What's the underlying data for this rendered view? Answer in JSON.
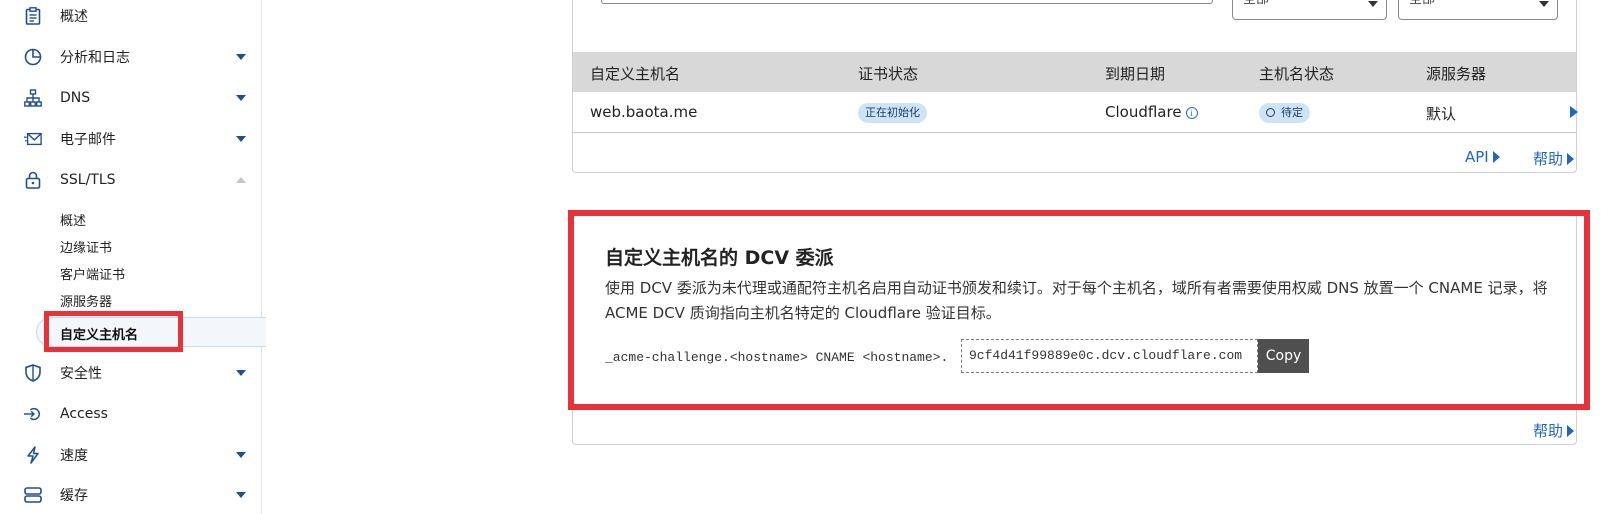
{
  "sidebar": {
    "items": [
      {
        "label": "概述",
        "icon": "clipboard-icon"
      },
      {
        "label": "分析和日志",
        "icon": "pie-chart-icon"
      },
      {
        "label": "DNS",
        "icon": "network-icon"
      },
      {
        "label": "电子邮件",
        "icon": "email-icon"
      },
      {
        "label": "SSL/TLS",
        "icon": "lock-icon"
      },
      {
        "label": "安全性",
        "icon": "shield-icon"
      },
      {
        "label": "Access",
        "icon": "access-icon"
      },
      {
        "label": "速度",
        "icon": "lightning-icon"
      },
      {
        "label": "缓存",
        "icon": "storage-icon"
      }
    ],
    "ssl_sub_items": [
      "概述",
      "边缘证书",
      "客户端证书",
      "源服务器",
      "自定义主机名"
    ]
  },
  "filters": {
    "status_select": "全部",
    "validation_select": "全部"
  },
  "table": {
    "headers": [
      "自定义主机名",
      "证书状态",
      "到期日期",
      "主机名状态",
      "源服务器"
    ],
    "row": {
      "hostname": "web.baota.me",
      "cert_status": "正在初始化",
      "expiry": "Cloudflare",
      "hostname_status": "待定",
      "origin": "默认"
    },
    "api_link": "API",
    "help_link": "帮助"
  },
  "dcv": {
    "title": "自定义主机名的 DCV 委派",
    "description": "使用 DCV 委派为未代理或通配符主机名启用自动证书颁发和续订。对于每个主机名，域所有者需要使用权威 DNS 放置一个 CNAME 记录，将 ACME DCV 质询指向主机名特定的 Cloudflare 验证目标。",
    "record": "_acme-challenge.<hostname> CNAME <hostname>.",
    "target": "9cf4d41f99889e0c.dcv.cloudflare.com",
    "copy_label": "Copy",
    "help_link": "帮助"
  },
  "colors": {
    "accent": "#1f66c1",
    "highlight": "#e8323a",
    "pill": "#cfe3f7"
  }
}
